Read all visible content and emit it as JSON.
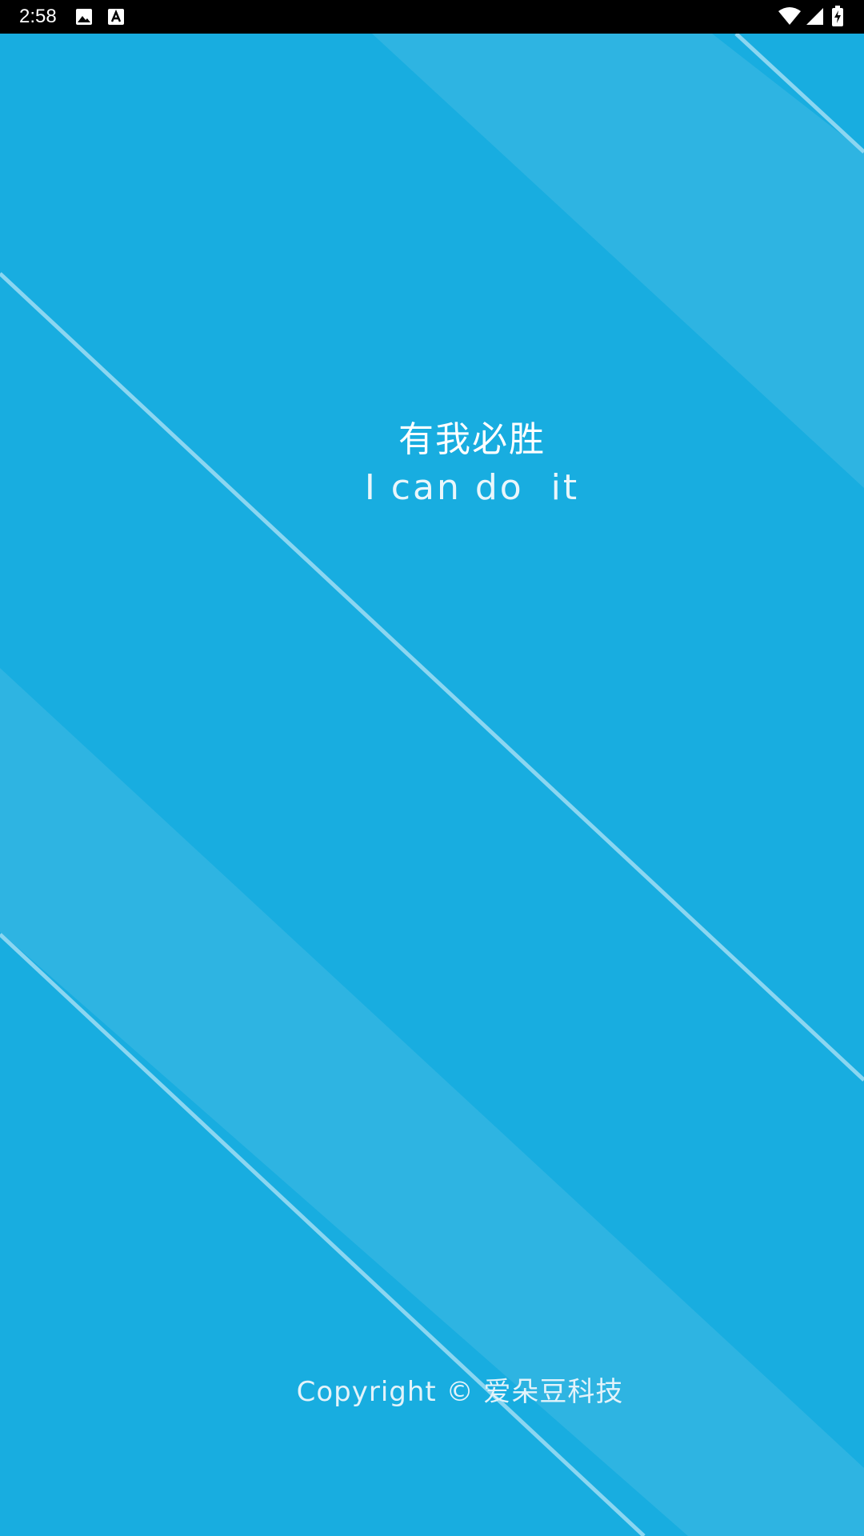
{
  "status_bar": {
    "time": "2:58",
    "left_icons": [
      "image-icon",
      "font-a-icon"
    ],
    "right_icons": [
      "wifi-icon",
      "cell-signal-icon",
      "battery-charging-icon"
    ]
  },
  "splash": {
    "slogan_cn": "有我必胜",
    "slogan_en": "I can do  it",
    "copyright": "Copyright © 爱朵豆科技"
  },
  "colors": {
    "background": "#18ADE0",
    "band": "#2EB4E2",
    "stripe": "#8BD6F1",
    "status_bar": "#000000",
    "text": "#FFFFFF"
  }
}
